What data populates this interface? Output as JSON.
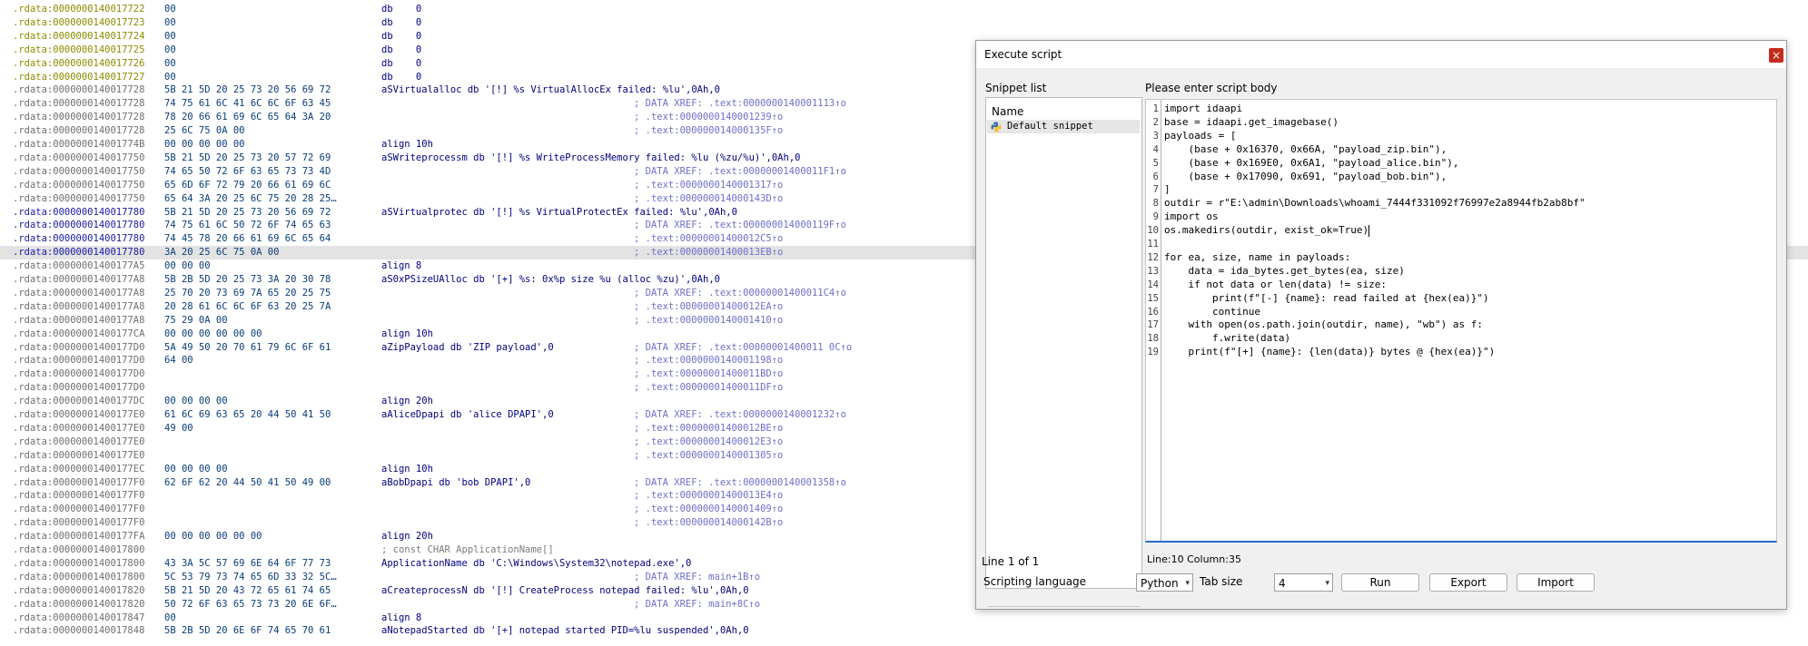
{
  "listing": {
    "lines": [
      {
        "addr": ".rdata:0000000140017722",
        "bytes": "00",
        "instr": "db    0",
        "xref": "",
        "style": "yel"
      },
      {
        "addr": ".rdata:0000000140017723",
        "bytes": "00",
        "instr": "db    0",
        "xref": "",
        "style": "yel"
      },
      {
        "addr": ".rdata:0000000140017724",
        "bytes": "00",
        "instr": "db    0",
        "xref": "",
        "style": "yel"
      },
      {
        "addr": ".rdata:0000000140017725",
        "bytes": "00",
        "instr": "db    0",
        "xref": "",
        "style": "yel"
      },
      {
        "addr": ".rdata:0000000140017726",
        "bytes": "00",
        "instr": "db    0",
        "xref": "",
        "style": "yel"
      },
      {
        "addr": ".rdata:0000000140017727",
        "bytes": "00",
        "instr": "db    0",
        "xref": "",
        "style": "yel"
      },
      {
        "addr": ".rdata:0000000140017728",
        "bytes": "5B 21 5D 20 25 73 20 56 69 72",
        "instr": "aSVirtualalloc db '[!] %s VirtualAllocEx failed: %lu',0Ah,0",
        "xref": "",
        "style": ""
      },
      {
        "addr": ".rdata:0000000140017728",
        "bytes": "74 75 61 6C 41 6C 6C 6F 63 45",
        "instr": "",
        "xref": "; DATA XREF: .text:0000000140001113↑o",
        "style": ""
      },
      {
        "addr": ".rdata:0000000140017728",
        "bytes": "78 20 66 61 69 6C 65 64 3A 20",
        "instr": "",
        "xref": "; .text:0000000140001239↑o",
        "style": ""
      },
      {
        "addr": ".rdata:0000000140017728",
        "bytes": "25 6C 75 0A 00",
        "instr": "",
        "xref": "; .text:000000014000135F↑o",
        "style": ""
      },
      {
        "addr": ".rdata:000000014001774B",
        "bytes": "00 00 00 00 00",
        "instr": "align 10h",
        "xref": "",
        "style": ""
      },
      {
        "addr": ".rdata:0000000140017750",
        "bytes": "5B 21 5D 20 25 73 20 57 72 69",
        "instr": "aSWriteprocessm db '[!] %s WriteProcessMemory failed: %lu (%zu/%u)',0Ah,0",
        "xref": "",
        "style": ""
      },
      {
        "addr": ".rdata:0000000140017750",
        "bytes": "74 65 50 72 6F 63 65 73 73 4D",
        "instr": "",
        "xref": "; DATA XREF: .text:00000001400011F1↑o",
        "style": ""
      },
      {
        "addr": ".rdata:0000000140017750",
        "bytes": "65 6D 6F 72 79 20 66 61 69 6C",
        "instr": "",
        "xref": "; .text:0000000140001317↑o",
        "style": ""
      },
      {
        "addr": ".rdata:0000000140017750",
        "bytes": "65 64 3A 20 25 6C 75 20 28 25…",
        "instr": "",
        "xref": "; .text:000000014000143D↑o",
        "style": ""
      },
      {
        "addr": ".rdata:0000000140017780",
        "bytes": "5B 21 5D 20 25 73 20 56 69 72",
        "instr": "aSVirtualprotec db '[!] %s VirtualProtectEx failed: %lu',0Ah,0",
        "xref": "",
        "style": "blue"
      },
      {
        "addr": ".rdata:0000000140017780",
        "bytes": "74 75 61 6C 50 72 6F 74 65 63",
        "instr": "",
        "xref": "; DATA XREF: .text:000000014000119F↑o",
        "style": "blue"
      },
      {
        "addr": ".rdata:0000000140017780",
        "bytes": "74 45 78 20 66 61 69 6C 65 64",
        "instr": "",
        "xref": "; .text:00000001400012C5↑o",
        "style": "blue"
      },
      {
        "addr": ".rdata:0000000140017780",
        "bytes": "3A 20 25 6C 75 0A 00",
        "instr": "",
        "xref": "; .text:00000001400013EB↑o",
        "style": "blue",
        "hl": true
      },
      {
        "addr": ".rdata:00000001400177A5",
        "bytes": "00 00 00",
        "instr": "align 8",
        "xref": "",
        "style": ""
      },
      {
        "addr": ".rdata:00000001400177A8",
        "bytes": "5B 2B 5D 20 25 73 3A 20 30 78",
        "instr": "aS0xPSizeUAlloc db '[+] %s: 0x%p size %u (alloc %zu)',0Ah,0",
        "xref": "",
        "style": ""
      },
      {
        "addr": ".rdata:00000001400177A8",
        "bytes": "25 70 20 73 69 7A 65 20 25 75",
        "instr": "",
        "xref": "; DATA XREF: .text:00000001400011C4↑o",
        "style": ""
      },
      {
        "addr": ".rdata:00000001400177A8",
        "bytes": "20 28 61 6C 6C 6F 63 20 25 7A",
        "instr": "",
        "xref": "; .text:00000001400012EA↑o",
        "style": ""
      },
      {
        "addr": ".rdata:00000001400177A8",
        "bytes": "75 29 0A 00",
        "instr": "",
        "xref": "; .text:0000000140001410↑o",
        "style": ""
      },
      {
        "addr": ".rdata:00000001400177CA",
        "bytes": "00 00 00 00 00 00",
        "instr": "align 10h",
        "xref": "",
        "style": ""
      },
      {
        "addr": ".rdata:00000001400177D0",
        "bytes": "5A 49 50 20 70 61 79 6C 6F 61",
        "instr": "aZipPayload db 'ZIP payload',0",
        "xref": "; DATA XREF: .text:00000001400011 0C↑o",
        "style": ""
      },
      {
        "addr": ".rdata:00000001400177D0",
        "bytes": "64 00",
        "instr": "",
        "xref": "; .text:0000000140001198↑o",
        "style": ""
      },
      {
        "addr": ".rdata:00000001400177D0",
        "bytes": "",
        "instr": "",
        "xref": "; .text:00000001400011BD↑o",
        "style": ""
      },
      {
        "addr": ".rdata:00000001400177D0",
        "bytes": "",
        "instr": "",
        "xref": "; .text:00000001400011DF↑o",
        "style": ""
      },
      {
        "addr": ".rdata:00000001400177DC",
        "bytes": "00 00 00 00",
        "instr": "align 20h",
        "xref": "",
        "style": ""
      },
      {
        "addr": ".rdata:00000001400177E0",
        "bytes": "61 6C 69 63 65 20 44 50 41 50",
        "instr": "aAliceDpapi db 'alice DPAPI',0",
        "xref": "; DATA XREF: .text:0000000140001232↑o",
        "style": ""
      },
      {
        "addr": ".rdata:00000001400177E0",
        "bytes": "49 00",
        "instr": "",
        "xref": "; .text:00000001400012BE↑o",
        "style": ""
      },
      {
        "addr": ".rdata:00000001400177E0",
        "bytes": "",
        "instr": "",
        "xref": "; .text:00000001400012E3↑o",
        "style": ""
      },
      {
        "addr": ".rdata:00000001400177E0",
        "bytes": "",
        "instr": "",
        "xref": "; .text:0000000140001305↑o",
        "style": ""
      },
      {
        "addr": ".rdata:00000001400177EC",
        "bytes": "00 00 00 00",
        "instr": "align 10h",
        "xref": "",
        "style": ""
      },
      {
        "addr": ".rdata:00000001400177F0",
        "bytes": "62 6F 62 20 44 50 41 50 49 00",
        "instr": "aBobDpapi db 'bob DPAPI',0",
        "xref": "; DATA XREF: .text:0000000140001358↑o",
        "style": ""
      },
      {
        "addr": ".rdata:00000001400177F0",
        "bytes": "",
        "instr": "",
        "xref": "; .text:00000001400013E4↑o",
        "style": ""
      },
      {
        "addr": ".rdata:00000001400177F0",
        "bytes": "",
        "instr": "",
        "xref": "; .text:0000000140001409↑o",
        "style": ""
      },
      {
        "addr": ".rdata:00000001400177F0",
        "bytes": "",
        "instr": "",
        "xref": "; .text:000000014000142B↑o",
        "style": ""
      },
      {
        "addr": ".rdata:00000001400177FA",
        "bytes": "00 00 00 00 00 00",
        "instr": "align 20h",
        "xref": "",
        "style": ""
      },
      {
        "addr": ".rdata:0000000140017800",
        "bytes": "",
        "instr": "; const CHAR ApplicationName[]",
        "xref": "",
        "style": ""
      },
      {
        "addr": ".rdata:0000000140017800",
        "bytes": "43 3A 5C 57 69 6E 64 6F 77 73",
        "instr": "ApplicationName db 'C:\\Windows\\System32\\notepad.exe',0",
        "xref": "",
        "style": ""
      },
      {
        "addr": ".rdata:0000000140017800",
        "bytes": "5C 53 79 73 74 65 6D 33 32 5C…",
        "instr": "",
        "xref": "; DATA XREF: main+1B↑o",
        "style": ""
      },
      {
        "addr": ".rdata:0000000140017820",
        "bytes": "5B 21 5D 20 43 72 65 61 74 65",
        "instr": "aCreateprocessN db '[!] CreateProcess notepad failed: %lu',0Ah,0",
        "xref": "",
        "style": ""
      },
      {
        "addr": ".rdata:0000000140017820",
        "bytes": "50 72 6F 63 65 73 73 20 6E 6F…",
        "instr": "",
        "xref": "; DATA XREF: main+8C↑o",
        "style": ""
      },
      {
        "addr": ".rdata:0000000140017847",
        "bytes": "00",
        "instr": "align 8",
        "xref": "",
        "style": ""
      },
      {
        "addr": ".rdata:0000000140017848",
        "bytes": "5B 2B 5D 20 6E 6F 74 65 70 61",
        "instr": "aNotepadStarted db '[+] notepad started PID=%lu suspended',0Ah,0",
        "xref": "",
        "style": ""
      }
    ]
  },
  "dialog": {
    "title": "Execute script",
    "close_glyph": "×",
    "snippet_list_label": "Snippet list",
    "snippet_column_header": "Name",
    "snippets": [
      "Default snippet"
    ],
    "snippet_count": "Line 1 of 1",
    "script_body_label": "Please enter script body",
    "status": "Line:10  Column:35",
    "code_lines": [
      "import idaapi",
      "base = idaapi.get_imagebase()",
      "payloads = [",
      "    (base + 0x16370, 0x66A, \"payload_zip.bin\"),",
      "    (base + 0x169E0, 0x6A1, \"payload_alice.bin\"),",
      "    (base + 0x17090, 0x691, \"payload_bob.bin\"),",
      "]",
      "outdir = r\"E:\\admin\\Downloads\\whoami_7444f331092f76997e2a8944fb2ab8bf\"",
      "import os",
      "os.makedirs(outdir, exist_ok=True)",
      "",
      "for ea, size, name in payloads:",
      "    data = ida_bytes.get_bytes(ea, size)",
      "    if not data or len(data) != size:",
      "        print(f\"[-] {name}: read failed at {hex(ea)}\")",
      "        continue",
      "    with open(os.path.join(outdir, name), \"wb\") as f:",
      "        f.write(data)",
      "    print(f\"[+] {name}: {len(data)} bytes @ {hex(ea)}\")"
    ],
    "scripting_language_label": "Scripting language",
    "scripting_language_value": "Python",
    "tab_size_label": "Tab size",
    "tab_size_value": "4",
    "run_label": "Run",
    "export_label": "Export",
    "import_label": "Import"
  }
}
